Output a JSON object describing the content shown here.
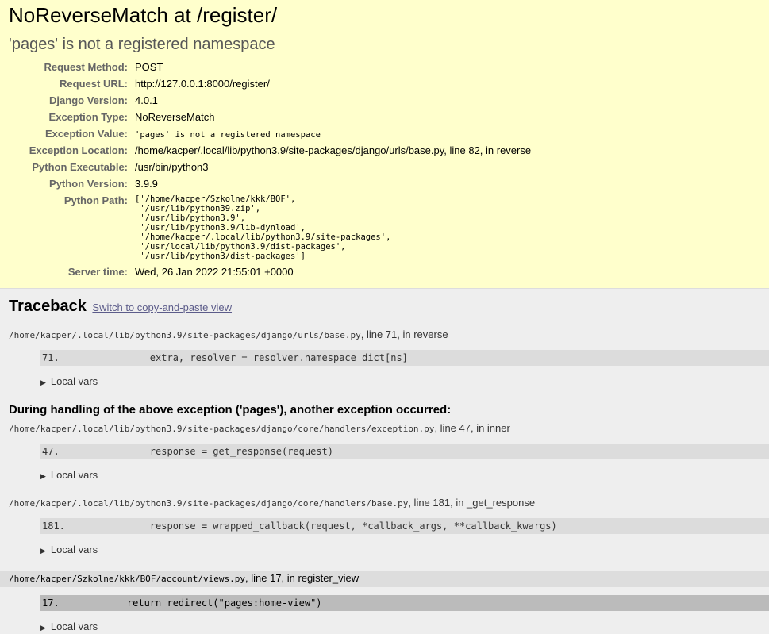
{
  "summary": {
    "title": "NoReverseMatch at /register/",
    "subtitle": "'pages' is not a registered namespace",
    "meta": [
      {
        "label": "Request Method:",
        "value": "POST"
      },
      {
        "label": "Request URL:",
        "value": "http://127.0.0.1:8000/register/"
      },
      {
        "label": "Django Version:",
        "value": "4.0.1"
      },
      {
        "label": "Exception Type:",
        "value": "NoReverseMatch"
      },
      {
        "label": "Exception Value:",
        "value": "'pages' is not a registered namespace"
      },
      {
        "label": "Exception Location:",
        "value": "/home/kacper/.local/lib/python3.9/site-packages/django/urls/base.py, line 82, in reverse"
      },
      {
        "label": "Python Executable:",
        "value": "/usr/bin/python3"
      },
      {
        "label": "Python Version:",
        "value": "3.9.9"
      },
      {
        "label": "Python Path:",
        "value": "['/home/kacper/Szkolne/kkk/BOF',\n '/usr/lib/python39.zip',\n '/usr/lib/python3.9',\n '/usr/lib/python3.9/lib-dynload',\n '/home/kacper/.local/lib/python3.9/site-packages',\n '/usr/local/lib/python3.9/dist-packages',\n '/usr/lib/python3/dist-packages']"
      },
      {
        "label": "Server time:",
        "value": "Wed, 26 Jan 2022 21:55:01 +0000"
      }
    ]
  },
  "traceback": {
    "title": "Traceback",
    "switch_link": "Switch to copy-and-paste view",
    "handling_message": "During handling of the above exception ('pages'), another exception occurred:",
    "local_vars_label": "Local vars",
    "frames": [
      {
        "path": "/home/kacper/.local/lib/python3.9/site-packages/django/urls/base.py",
        "suffix": ", line 71, in reverse",
        "lineno": "71.",
        "code": "        extra, resolver = resolver.namespace_dict[ns]"
      },
      {
        "path": "/home/kacper/.local/lib/python3.9/site-packages/django/core/handlers/exception.py",
        "suffix": ", line 47, in inner",
        "lineno": "47.",
        "code": "        response = get_response(request)"
      },
      {
        "path": "/home/kacper/.local/lib/python3.9/site-packages/django/core/handlers/base.py",
        "suffix": ", line 181, in _get_response",
        "lineno": "181.",
        "code": "        response = wrapped_callback(request, *callback_args, **callback_kwargs)"
      },
      {
        "path": "/home/kacper/Szkolne/kkk/BOF/account/views.py",
        "suffix": ", line 17, in register_view",
        "lineno": "17.",
        "code": "    return redirect(\"pages:home-view\")"
      }
    ]
  }
}
